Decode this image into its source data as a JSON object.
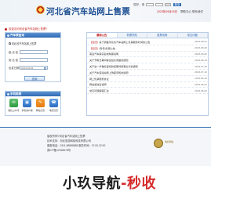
{
  "header": {
    "title": "河北省汽车站网上售票",
    "login_label": "您好，请",
    "login_button": "登录",
    "date_text": "2023年09月03日",
    "links": [
      "帮助中心",
      "联系我们"
    ]
  },
  "notice": "欢迎访问河北省汽车站网上售票！",
  "ticket_panel": {
    "title": "汽车票查询",
    "radio_label": "河北省汽车站网上售票",
    "from_label": "起 点 站",
    "to_label": "到 达 站",
    "date_label": "出发日期",
    "date_value": "2023-09-03",
    "query_button": "查询"
  },
  "mobile_panel": {
    "title": "手机购票",
    "items": [
      {
        "icon": "wechat-icon",
        "label": "微信公众号"
      },
      {
        "icon": "app-icon",
        "label": "手机客户端"
      },
      {
        "icon": "order-icon",
        "label": "网站订票"
      },
      {
        "icon": "phone-icon",
        "label": "电话订票"
      }
    ]
  },
  "news_panel": {
    "tabs": [
      "最新公告",
      "购票须知",
      "退票说明",
      "常见问题"
    ],
    "items": [
      {
        "tag": "【置顶】",
        "title": "关于调整河北省汽车站网上售票服务时间的公告",
        "date": "2023-09-01"
      },
      {
        "tag": "【置顶】",
        "title": "(暂停)售票公告",
        "date": "2023-08-28"
      },
      {
        "tag": "",
        "title": "客运汽车票实名制购票说明",
        "date": "2023-08-20"
      },
      {
        "tag": "",
        "title": "关于节假日期间客运班次调整的通知",
        "date": "2023-08-15"
      },
      {
        "tag": "",
        "title": "关于进一步做好疫情防控期间旅客出行的通知",
        "date": "2023-07-30"
      },
      {
        "tag": "",
        "title": "关于汽车客运站网上购票须知的说明",
        "date": "2023-07-12"
      },
      {
        "tag": "",
        "title": "网上售票服务协议",
        "date": "2023-06-18"
      },
      {
        "tag": "",
        "title": "网站退改签说明",
        "date": "2023-05-22"
      },
      {
        "tag": "",
        "title": "常见问题解答汇总",
        "date": "2023-05-02"
      }
    ]
  },
  "footer": {
    "lines": [
      "版权所有©河北省汽车站网上售票",
      "技术支持：河北旅游网络科技有限公司",
      "客服电话：0311-88888888  服务时间：07:00-22:00",
      "冀ICP备12345678号"
    ],
    "badge": "诚信网站"
  },
  "watermark": {
    "text_a": "小玖导航",
    "text_b": "-秒收"
  }
}
